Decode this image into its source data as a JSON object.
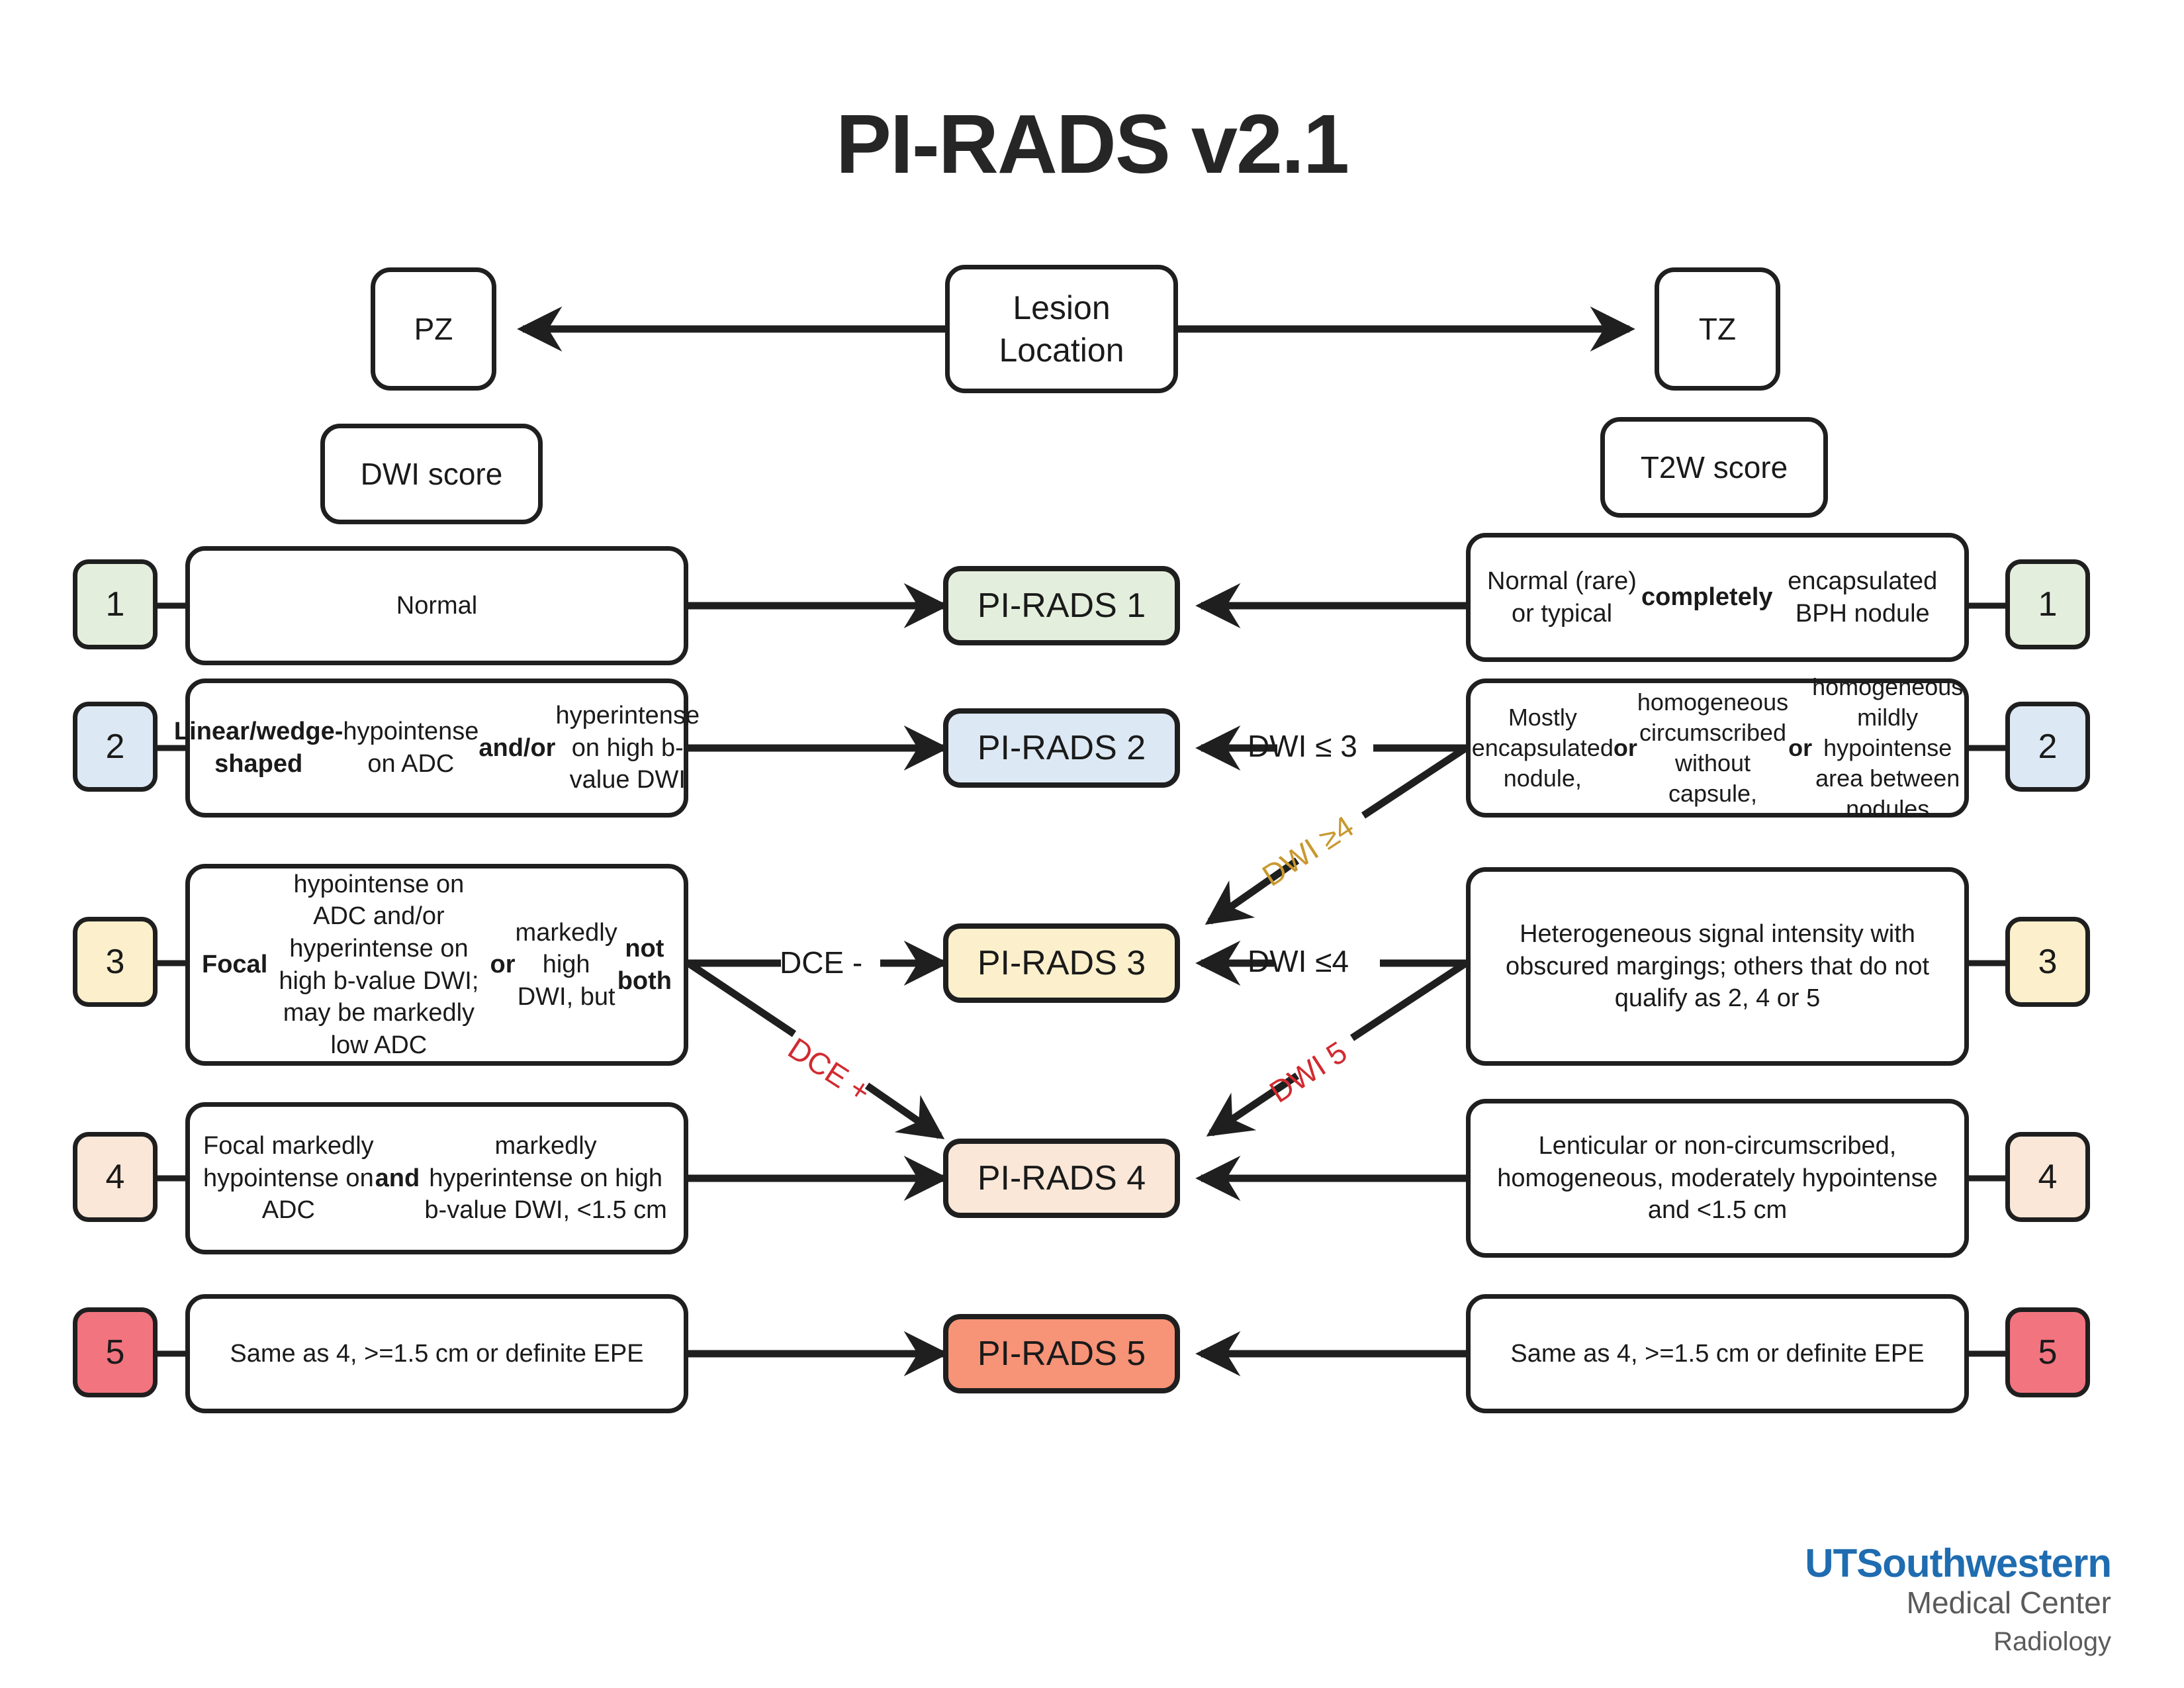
{
  "title": "PI-RADS v2.1",
  "header": {
    "lesion_location": "Lesion\nLocation",
    "pz": "PZ",
    "tz": "TZ",
    "dwi_score": "DWI score",
    "t2w_score": "T2W score"
  },
  "left_column": {
    "title": "DWI score",
    "rows": [
      {
        "score": "1",
        "score_color": "#e4eedc",
        "text_html": "Normal",
        "text_plain": "Normal"
      },
      {
        "score": "2",
        "score_color": "#dce8f3",
        "text_html": "<b>Linear/wedge-shaped</b> hypointense on ADC <b>and/or</b> hyperintense on high b-value DWI",
        "text_plain": "Linear/wedge-shaped hypointense on ADC and/or hyperintense on high b-value DWI"
      },
      {
        "score": "3",
        "score_color": "#fbf0cb",
        "text_html": "<b>Focal</b> hypointense on ADC and/or hyperintense on high b-value DWI; may be markedly low ADC <b>or</b> markedly high DWI, but <b>not both</b>",
        "text_plain": "Focal hypointense on ADC and/or hyperintense on high b-value DWI; may be markedly low ADC or markedly high DWI, but not both"
      },
      {
        "score": "4",
        "score_color": "#fae7d7",
        "text_html": "Focal markedly hypointense on ADC <b>and</b> markedly hyperintense on high b-value DWI, &lt;1.5 cm",
        "text_plain": "Focal markedly hypointense on ADC and markedly hyperintense on high b-value DWI, <1.5 cm"
      },
      {
        "score": "5",
        "score_color": "#f2747f",
        "text_html": "Same as 4, &gt;=1.5 cm or definite EPE",
        "text_plain": "Same as 4, >=1.5 cm or definite EPE"
      }
    ]
  },
  "center_column": {
    "results": [
      {
        "label": "PI-RADS 1",
        "color": "#e4eedc"
      },
      {
        "label": "PI-RADS 2",
        "color": "#dce8f3"
      },
      {
        "label": "PI-RADS 3",
        "color": "#fbf0cb"
      },
      {
        "label": "PI-RADS 4",
        "color": "#fae7d7"
      },
      {
        "label": "PI-RADS 5",
        "color": "#f79377"
      }
    ]
  },
  "right_column": {
    "title": "T2W score",
    "rows": [
      {
        "score": "1",
        "score_color": "#e4eedc",
        "text_html": "Normal (rare) or typical <b>completely</b> encapsulated BPH nodule",
        "text_plain": "Normal (rare) or typical completely encapsulated BPH nodule"
      },
      {
        "score": "2",
        "score_color": "#dce8f3",
        "text_html": "Mostly encapsulated nodule, <b>or</b> homogeneous circumscribed without capsule, <b>or</b> homogeneous mildly hypointense area between nodules",
        "text_plain": "Mostly encapsulated nodule, or homogeneous circumscribed without capsule, or homogeneous mildly hypointense area between nodules"
      },
      {
        "score": "3",
        "score_color": "#fbf0cb",
        "text_html": "Heterogeneous signal intensity with obscured margings; others that do not qualify as 2, 4 or 5",
        "text_plain": "Heterogeneous signal intensity with obscured margings; others that do not qualify as 2, 4 or 5"
      },
      {
        "score": "4",
        "score_color": "#fae7d7",
        "text_html": "Lenticular or non-circumscribed, homogeneous, moderately hypointense and &lt;1.5 cm",
        "text_plain": "Lenticular or non-circumscribed, homogeneous, moderately hypointense and <1.5 cm"
      },
      {
        "score": "5",
        "score_color": "#f2747f",
        "text_html": "Same as 4, &gt;=1.5 cm or definite EPE",
        "text_plain": "Same as 4, >=1.5 cm or definite EPE"
      }
    ]
  },
  "edge_labels": {
    "dce_minus": "DCE -",
    "dce_plus": "DCE +",
    "dwi_le_3": "DWI ≤ 3",
    "dwi_ge_4": "DWI ≥4",
    "dwi_le_4": "DWI ≤4",
    "dwi_5": "DWI 5"
  },
  "colors": {
    "stroke": "#1f1f1f",
    "gold": "#c8982f",
    "red": "#d12a30",
    "logo_blue": "#1f6cb0",
    "logo_gray": "#5a5a5a"
  },
  "logo": {
    "name_ut": "UT",
    "name_southwestern": "Southwestern",
    "line2": "Medical Center",
    "line3": "Radiology"
  }
}
